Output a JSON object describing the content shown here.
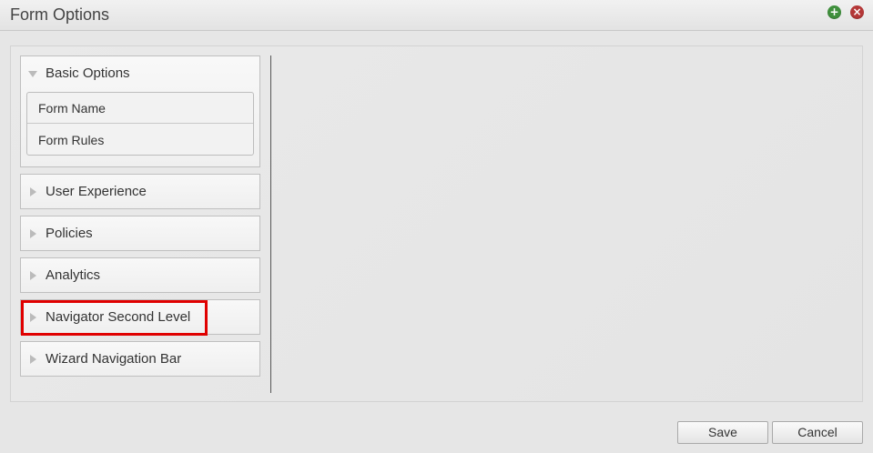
{
  "window": {
    "title": "Form Options",
    "add_icon": "plus-circle-icon",
    "close_icon": "x-circle-icon",
    "add_color": "#3f8f3c",
    "close_color": "#b43737"
  },
  "sidebar": {
    "sections": [
      {
        "label": "Basic Options",
        "expanded": true,
        "items": [
          {
            "label": "Form Name"
          },
          {
            "label": "Form Rules"
          }
        ]
      },
      {
        "label": "User Experience",
        "expanded": false
      },
      {
        "label": "Policies",
        "expanded": false
      },
      {
        "label": "Analytics",
        "expanded": false
      },
      {
        "label": "Navigator Second Level",
        "expanded": false,
        "highlighted": true
      },
      {
        "label": "Wizard Navigation Bar",
        "expanded": false
      }
    ],
    "highlight_color": "#e00000"
  },
  "footer": {
    "save_label": "Save",
    "cancel_label": "Cancel"
  }
}
